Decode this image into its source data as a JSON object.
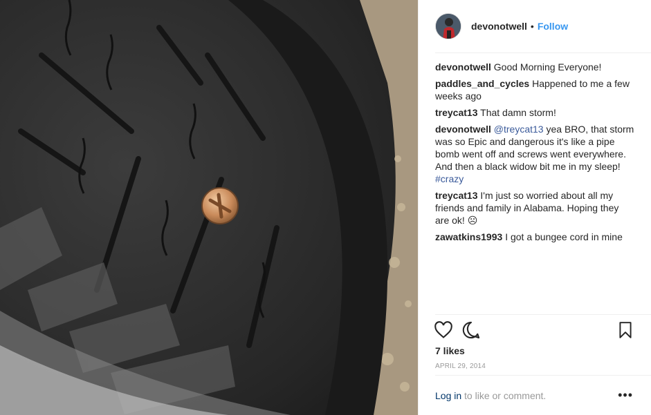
{
  "post": {
    "author": "devonotwell",
    "separator": "•",
    "follow_label": "Follow",
    "likes": "7 likes",
    "date": "APRIL 29, 2014",
    "login_link": "Log in",
    "login_rest": " to like or comment.",
    "more_label": "•••"
  },
  "comments": [
    {
      "user": "devonotwell",
      "text": "Good Morning Everyone!"
    },
    {
      "user": "paddles_and_cycles",
      "text": "Happened to me a few weeks ago"
    },
    {
      "user": "treycat13",
      "text": "That damn storm!"
    },
    {
      "user": "devonotwell",
      "mention": "@treycat13",
      "text": " yea BRO, that storm was so Epic and dangerous it's like a pipe bomb went off and screws went everywhere. And then a black widow bit me in my sleep! ",
      "tag": "#crazy"
    },
    {
      "user": "treycat13",
      "text": "I'm just so worried about all my friends and family in Alabama. Hoping they are ok! ☹"
    },
    {
      "user": "zawatkins1993",
      "text": "I got a bungee cord in mine"
    }
  ],
  "icons": [
    "heart-icon",
    "comment-icon",
    "bookmark-icon"
  ],
  "colors": {
    "link": "#3897f0",
    "text": "#262626",
    "muted": "#999999",
    "login_link": "#003569"
  }
}
